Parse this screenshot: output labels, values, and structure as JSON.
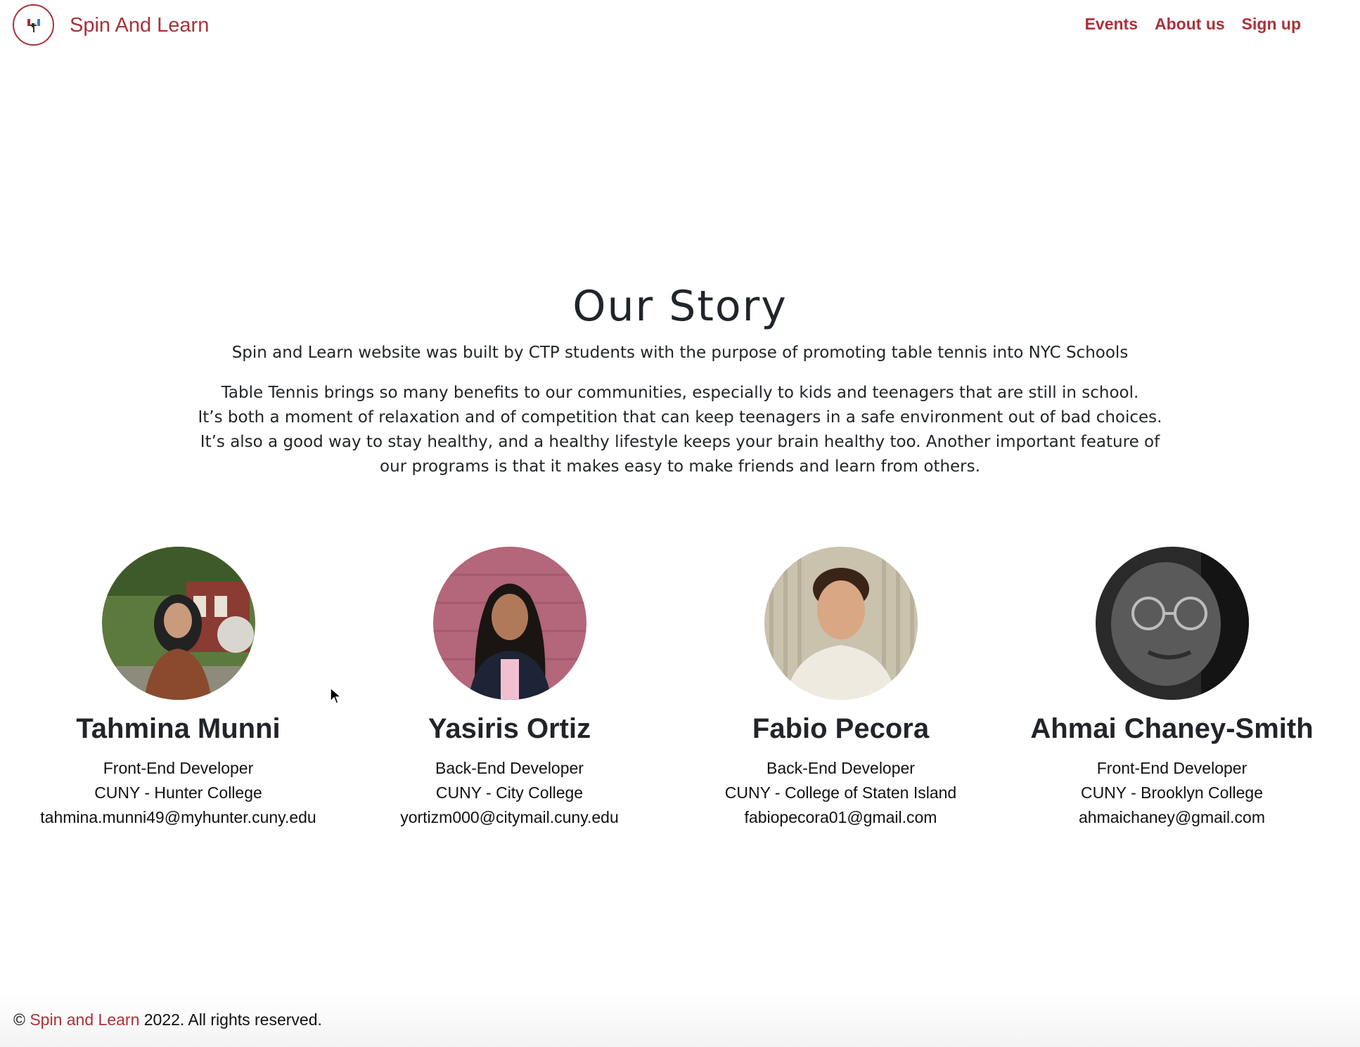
{
  "header": {
    "brand": "Spin And Learn",
    "nav": [
      "Events",
      "About us",
      "Sign up"
    ],
    "brand_color": "#a8323a"
  },
  "story": {
    "title": "Our Story",
    "intro": "Spin and Learn website was built by CTP students with the purpose of promoting table tennis into NYC Schools",
    "body_lines": [
      "Table Tennis brings so many benefits to our communities, especially to kids and teenagers that are still in school.",
      "It’s both a moment of relaxation and of competition that can keep teenagers in a safe environment out of bad choices.",
      "It’s also a good way to stay healthy, and a healthy lifestyle keeps your brain healthy too. Another important feature of",
      "our programs is that it makes easy to make friends and learn from others."
    ]
  },
  "team": [
    {
      "name": "Tahmina Munni",
      "role": "Front-End Developer",
      "school": "CUNY - Hunter College",
      "email": "tahmina.munni49@myhunter.cuny.edu"
    },
    {
      "name": "Yasiris Ortiz",
      "role": "Back-End Developer",
      "school": "CUNY - City College",
      "email": "yortizm000@citymail.cuny.edu"
    },
    {
      "name": "Fabio Pecora",
      "role": "Back-End Developer",
      "school": "CUNY - College of Staten Island",
      "email": "fabiopecora01@gmail.com"
    },
    {
      "name": "Ahmai Chaney-Smith",
      "role": "Front-End Developer",
      "school": "CUNY - Brooklyn College",
      "email": "ahmaichaney@gmail.com"
    }
  ],
  "footer": {
    "copyright_symbol": "©",
    "brand": "Spin and Learn",
    "suffix": "2022. All rights reserved."
  }
}
